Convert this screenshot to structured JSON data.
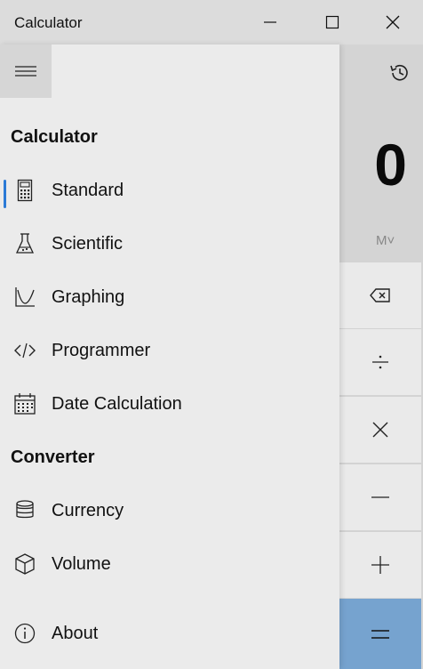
{
  "window": {
    "title": "Calculator"
  },
  "calculator": {
    "display": "0",
    "memory_label": "M˅"
  },
  "nav": {
    "section_calculator": "Calculator",
    "section_converter": "Converter",
    "items": [
      {
        "label": "Standard",
        "icon": "calculator-icon",
        "selected": true
      },
      {
        "label": "Scientific",
        "icon": "flask-icon"
      },
      {
        "label": "Graphing",
        "icon": "graph-icon"
      },
      {
        "label": "Programmer",
        "icon": "code-icon"
      },
      {
        "label": "Date Calculation",
        "icon": "calendar-icon"
      },
      {
        "label": "Currency",
        "icon": "coins-icon"
      },
      {
        "label": "Volume",
        "icon": "cube-icon"
      },
      {
        "label": "About",
        "icon": "info-icon"
      }
    ]
  },
  "colors": {
    "accent": "#2b7ad6",
    "equals_key": "#76a3cf"
  }
}
